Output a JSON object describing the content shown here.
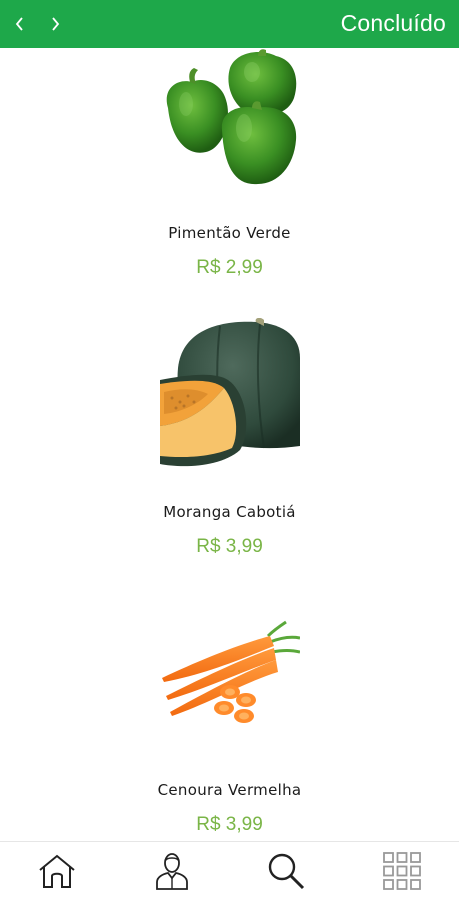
{
  "header": {
    "back_icon": "chevron-left-icon",
    "forward_icon": "chevron-right-icon",
    "done_label": "Concluído",
    "bar_color": "#1ea84a"
  },
  "products": [
    {
      "name": "Pimentão Verde",
      "price": "R$ 2,99",
      "image": "green-bell-pepper-image"
    },
    {
      "name": "Moranga Cabotiá",
      "price": "R$ 3,99",
      "image": "cabotia-pumpkin-image"
    },
    {
      "name": "Cenoura Vermelha",
      "price": "R$ 3,99",
      "image": "carrot-image"
    }
  ],
  "bottom_nav": {
    "items": [
      "home-icon",
      "user-icon",
      "search-icon",
      "grid-menu-icon"
    ]
  },
  "colors": {
    "price": "#7ab547"
  }
}
